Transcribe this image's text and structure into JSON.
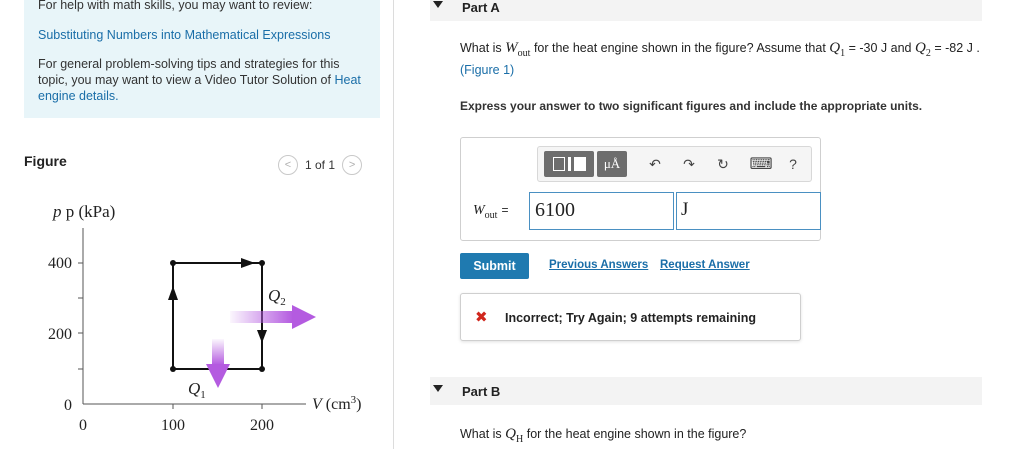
{
  "help": {
    "line1": "For help with math skills, you may want to review:",
    "link1": "Substituting Numbers into Mathematical Expressions",
    "para_text": "For general problem-solving tips and strategies for this topic, you may want to view a Video Tutor Solution of",
    "para_link": "Heat engine details."
  },
  "figure": {
    "title": "Figure",
    "pager_prev": "<",
    "pager_count": "1 of 1",
    "pager_next": ">",
    "y_label": "p (kPa)",
    "x_label_var": "V",
    "x_label_unit": "(cm",
    "x_label_exp": "3",
    "x_label_close": ")",
    "y_ticks": [
      "400",
      "200",
      "0"
    ],
    "x_ticks": [
      "0",
      "100",
      "200"
    ],
    "q1": "Q",
    "q1_sub": "1",
    "q2": "Q",
    "q2_sub": "2",
    "arrow_color": "#b45be0"
  },
  "partA": {
    "label": "Part A",
    "q_pre": "What is",
    "w_var": "W",
    "w_sub": "out",
    "q_mid": "for the heat engine shown in the figure? Assume that",
    "q1_var": "Q",
    "q1_sub": "1",
    "q1_val": "= -30 J and",
    "q2_var": "Q",
    "q2_sub": "2",
    "q2_val": "= -82 J .",
    "figure_link": "(Figure 1)",
    "instruction": "Express your answer to two significant figures and include the appropriate units.",
    "toolbar": {
      "mu_label": "μÅ",
      "undo": "↶",
      "redo": "↷",
      "reset": "↻",
      "keyboard": "⌨",
      "help": "?"
    },
    "answer_var": "W",
    "answer_sub": "out",
    "answer_eq": "=",
    "answer_value": "6100",
    "answer_unit": "J",
    "submit": "Submit",
    "previous_answers": "Previous Answers",
    "request_answer": "Request Answer",
    "feedback_icon": "✖",
    "feedback_msg": "Incorrect; Try Again; 9 attempts remaining"
  },
  "partB": {
    "label": "Part B",
    "q_pre": "What is",
    "q_var": "Q",
    "q_sub": "H",
    "q_post": "for the heat engine shown in the figure?"
  }
}
